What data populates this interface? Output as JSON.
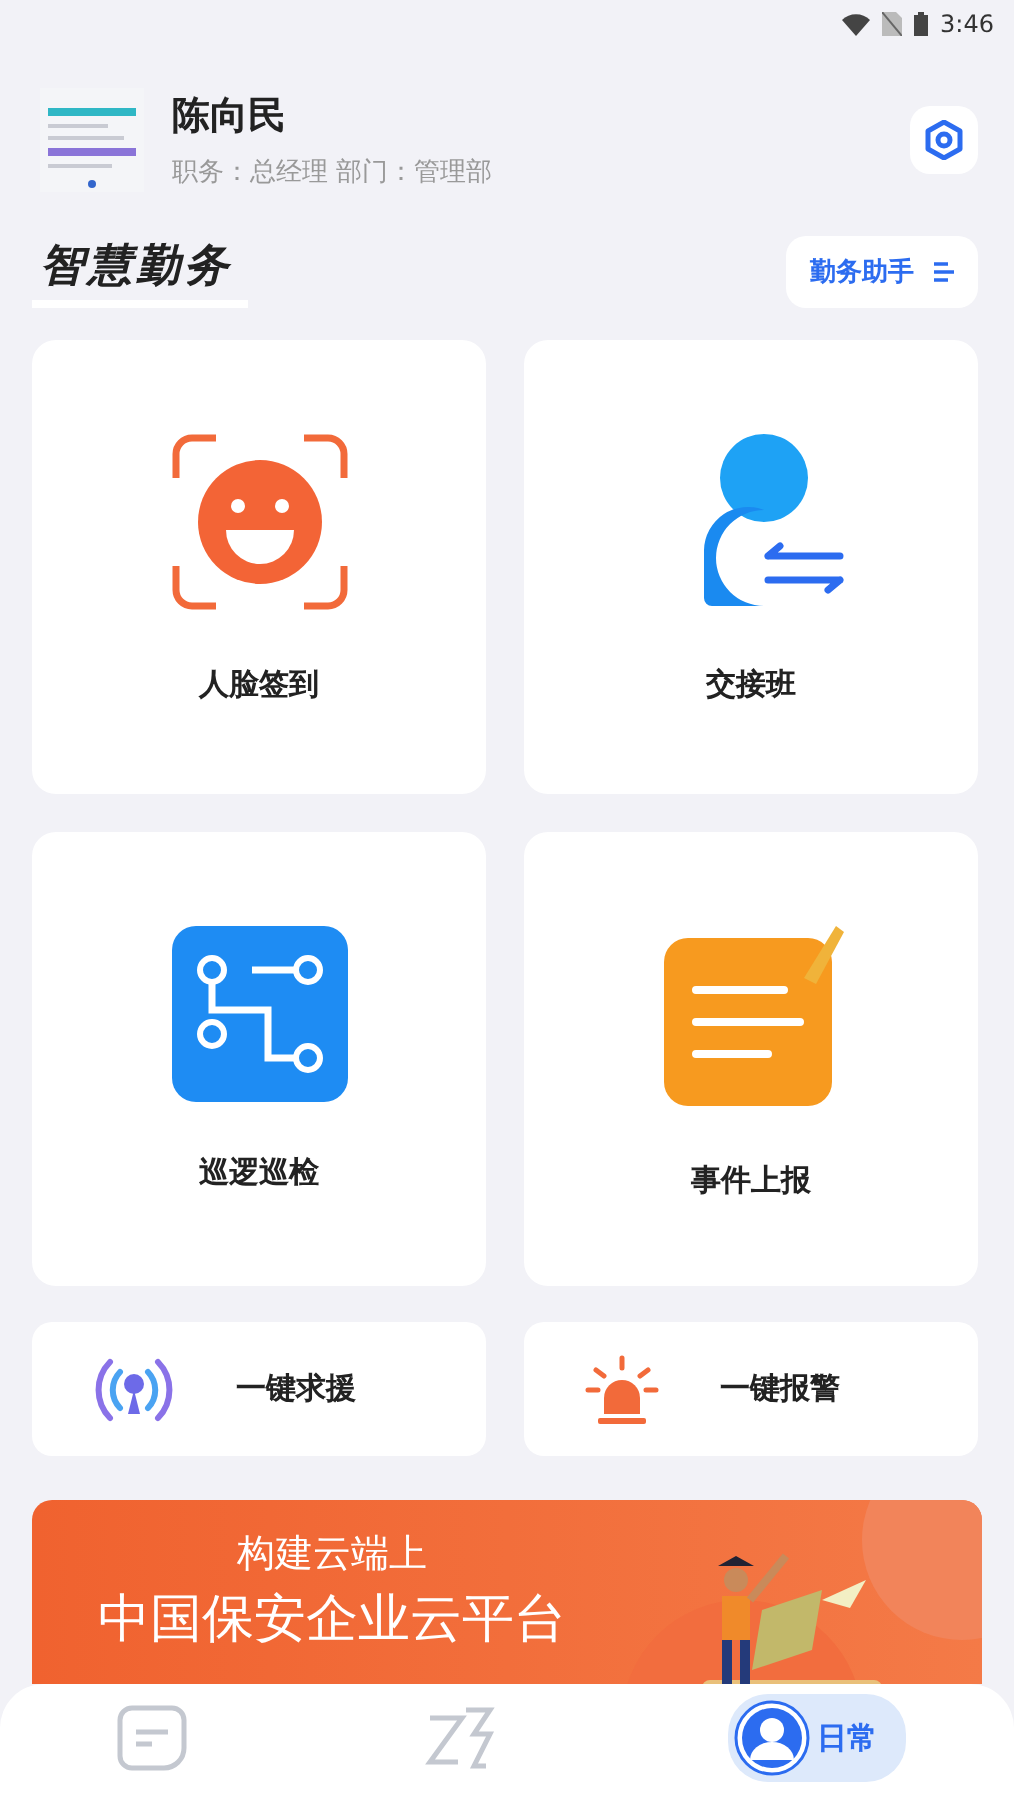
{
  "status_bar": {
    "time": "3:46"
  },
  "profile": {
    "name": "陈向民",
    "details": "职务：总经理 部门：管理部"
  },
  "section": {
    "title": "智慧勤务",
    "assistant_button": "勤务助手"
  },
  "tiles": [
    {
      "kind": "face",
      "label": "人脸签到"
    },
    {
      "kind": "handover",
      "label": "交接班"
    },
    {
      "kind": "patrol",
      "label": "巡逻巡检"
    },
    {
      "kind": "report",
      "label": "事件上报"
    }
  ],
  "quick_actions": [
    {
      "kind": "help",
      "label": "一键求援"
    },
    {
      "kind": "alarm",
      "label": "一键报警"
    }
  ],
  "banner": {
    "line_1": "构建云端上",
    "line_2": "中国保安企业云平台"
  },
  "bottom_nav": [
    {
      "kind": "notes",
      "selected": false
    },
    {
      "kind": "logo",
      "selected": false
    },
    {
      "kind": "profile",
      "label": "日常",
      "selected": true
    }
  ]
}
